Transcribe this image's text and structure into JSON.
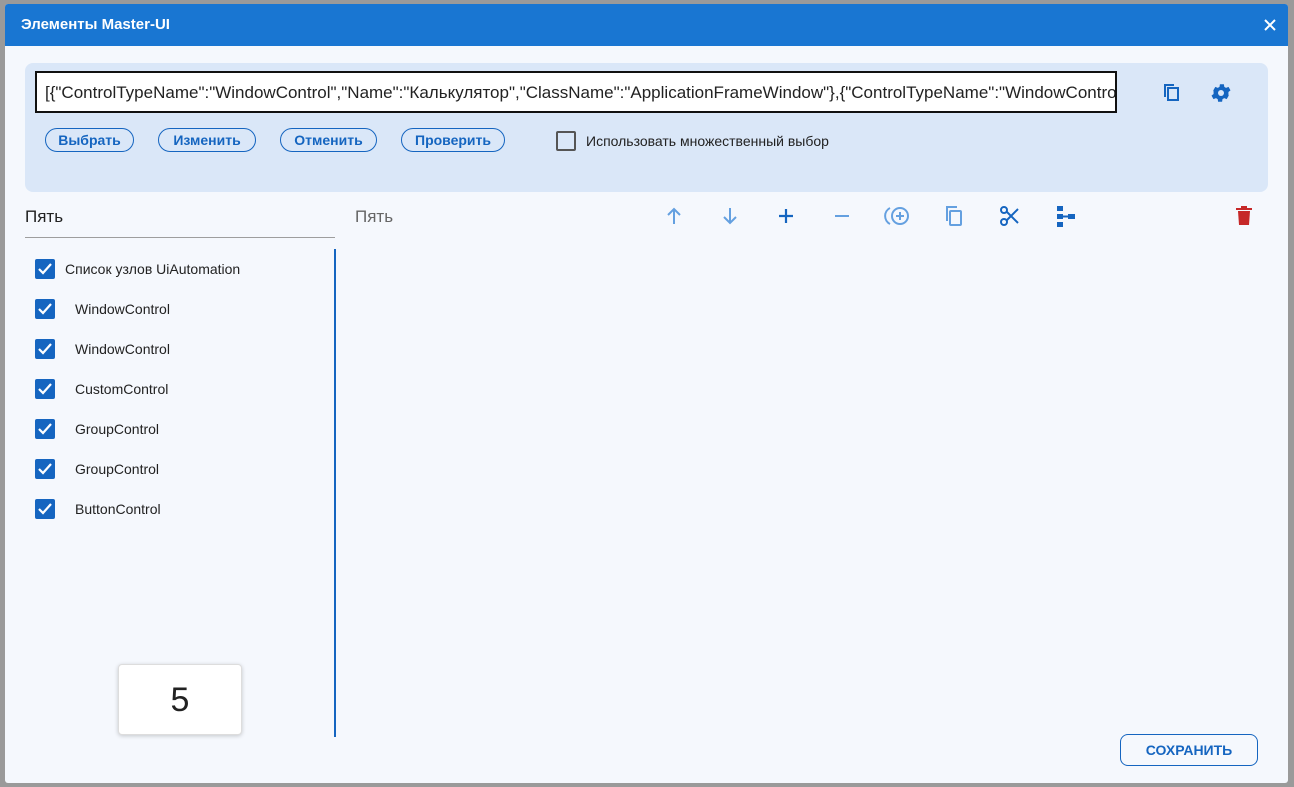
{
  "window": {
    "title": "Элементы Master-UI"
  },
  "selector": {
    "value": "[{\"ControlTypeName\":\"WindowControl\",\"Name\":\"Калькулятор\",\"ClassName\":\"ApplicationFrameWindow\"},{\"ControlTypeName\":\"WindowControl\",\"Name\":\"Калькулятор\",\"ClassName\":\"Windows.UI.Core.CoreWindow\"}]"
  },
  "actions": {
    "select": "Выбрать",
    "change": "Изменить",
    "cancel": "Отменить",
    "check": "Проверить",
    "multi_select": "Использовать множественный выбор",
    "multi_select_checked": false
  },
  "left_panel": {
    "header": "Пять",
    "tree": [
      {
        "label": "Список узлов UiAutomation",
        "checked": true,
        "level": 0
      },
      {
        "label": "WindowControl",
        "checked": true,
        "level": 1
      },
      {
        "label": "WindowControl",
        "checked": true,
        "level": 1
      },
      {
        "label": "CustomControl",
        "checked": true,
        "level": 1
      },
      {
        "label": "GroupControl",
        "checked": true,
        "level": 1
      },
      {
        "label": "GroupControl",
        "checked": true,
        "level": 1
      },
      {
        "label": "ButtonControl",
        "checked": true,
        "level": 1
      }
    ],
    "preview_value": "5"
  },
  "right_panel": {
    "header": "Пять"
  },
  "footer": {
    "save": "СОХРАНИТЬ"
  },
  "colors": {
    "primary": "#1976d2",
    "accent": "#1565c0",
    "icon_light": "#64a0e0",
    "danger": "#c62828",
    "panel_bg": "#dae7f8"
  }
}
